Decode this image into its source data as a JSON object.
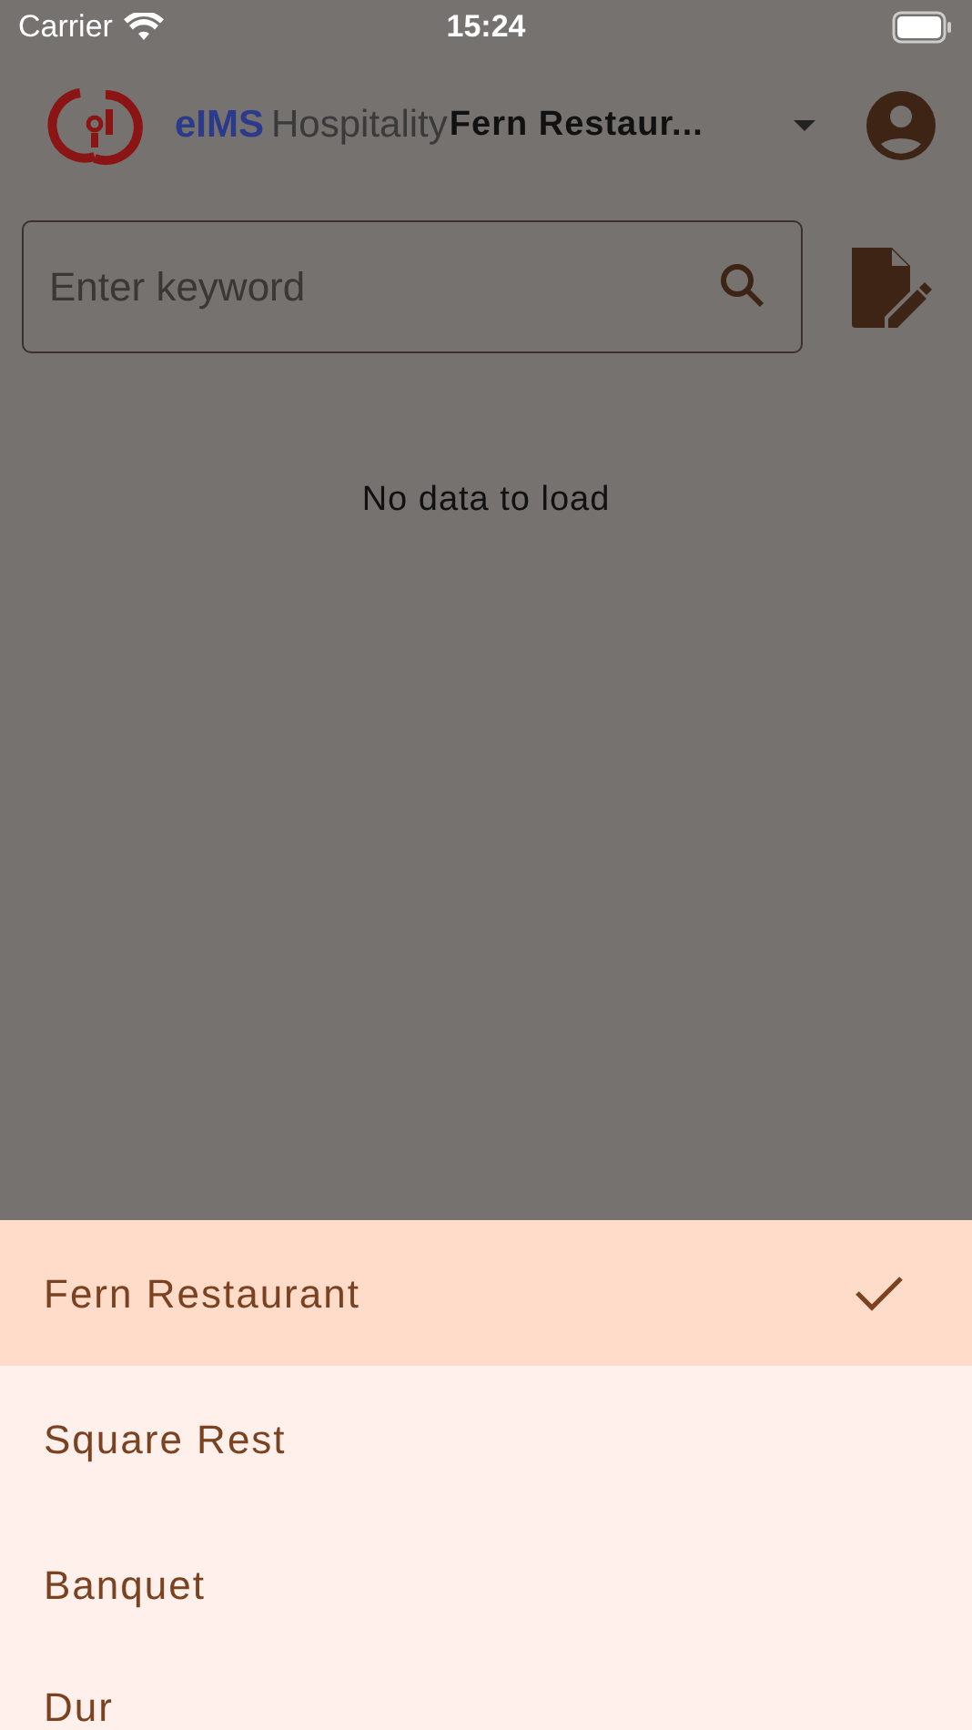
{
  "status_bar": {
    "carrier": "Carrier",
    "time": "15:24"
  },
  "header": {
    "logo_brand": "eIMS",
    "logo_suffix": "Hospitality",
    "outlet": "Fern Restaur..."
  },
  "search": {
    "placeholder": "Enter keyword"
  },
  "empty_message": "No data to load",
  "outlets": [
    {
      "name": "Fern Restaurant",
      "selected": true
    },
    {
      "name": "Square Rest",
      "selected": false
    },
    {
      "name": "Banquet",
      "selected": false
    },
    {
      "name": "Dur",
      "selected": false
    }
  ]
}
